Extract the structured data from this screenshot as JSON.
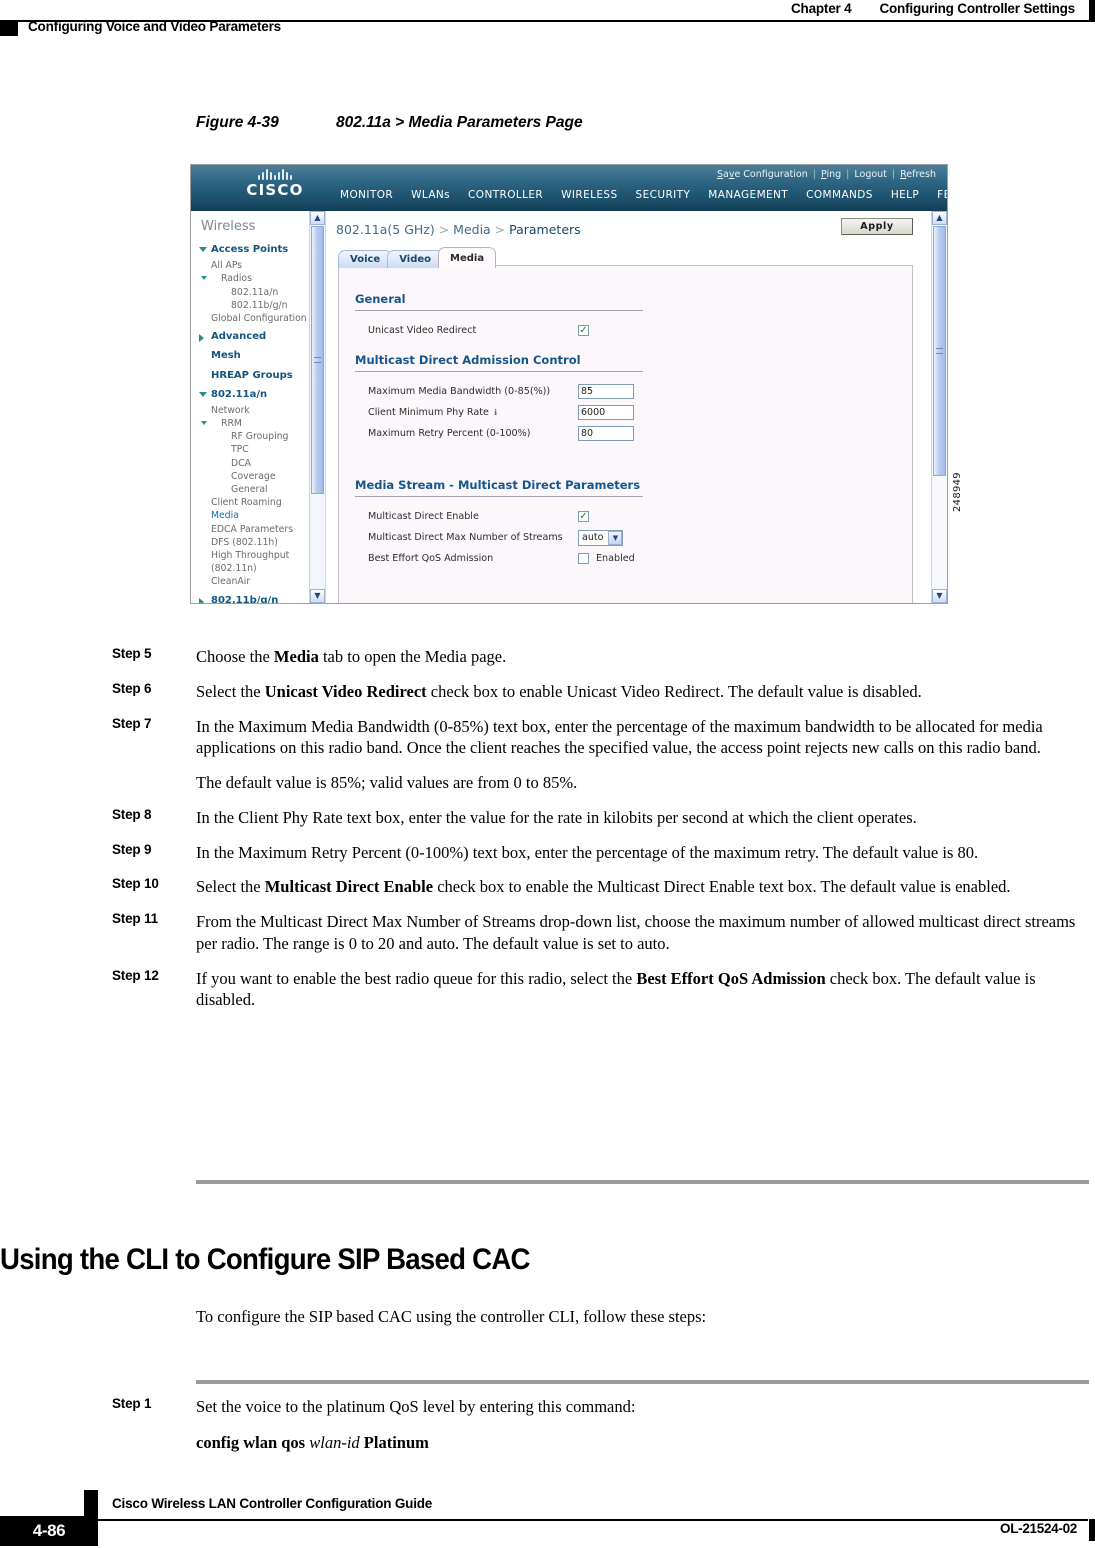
{
  "page_header": {
    "chapter_label": "Chapter 4",
    "chapter_title": "Configuring Controller Settings",
    "section_title": "Configuring Voice and Video Parameters"
  },
  "figure": {
    "number": "Figure 4-39",
    "title": "802.11a > Media Parameters Page",
    "image_id": "248949"
  },
  "screenshot": {
    "brand": "CISCO",
    "util_links": [
      {
        "label": "Save Configuration"
      },
      {
        "label": "Ping"
      },
      {
        "label": "Logout"
      },
      {
        "label": "Refresh"
      }
    ],
    "separator": "|",
    "main_nav": [
      {
        "label": "MONITOR",
        "active": false
      },
      {
        "label": "WLANs",
        "active": false
      },
      {
        "label": "CONTROLLER",
        "active": false
      },
      {
        "label": "WIRELESS",
        "active": true
      },
      {
        "label": "SECURITY",
        "active": false
      },
      {
        "label": "MANAGEMENT",
        "active": false
      },
      {
        "label": "COMMANDS",
        "active": false
      },
      {
        "label": "HELP",
        "active": false
      },
      {
        "label": "FEEDBACK",
        "active": false
      }
    ],
    "sidebar": {
      "title": "Wireless",
      "items": [
        {
          "label": "Access Points",
          "level": "group",
          "expanded": true
        },
        {
          "label": "All APs",
          "level": "1"
        },
        {
          "label": "Radios",
          "level": "1b",
          "expanded": true
        },
        {
          "label": "802.11a/n",
          "level": "2"
        },
        {
          "label": "802.11b/g/n",
          "level": "2"
        },
        {
          "label": "Global Configuration",
          "level": "1"
        },
        {
          "label": "Advanced",
          "level": "group",
          "expanded": false
        },
        {
          "label": "Mesh",
          "level": "group-plain"
        },
        {
          "label": "HREAP Groups",
          "level": "group-plain"
        },
        {
          "label": "802.11a/n",
          "level": "group",
          "expanded": true
        },
        {
          "label": "Network",
          "level": "1"
        },
        {
          "label": "RRM",
          "level": "1b",
          "expanded": true
        },
        {
          "label": "RF Grouping",
          "level": "2"
        },
        {
          "label": "TPC",
          "level": "2"
        },
        {
          "label": "DCA",
          "level": "2"
        },
        {
          "label": "Coverage",
          "level": "2"
        },
        {
          "label": "General",
          "level": "2"
        },
        {
          "label": "Client Roaming",
          "level": "1"
        },
        {
          "label": "Media",
          "level": "1",
          "selected": true
        },
        {
          "label": "EDCA Parameters",
          "level": "1"
        },
        {
          "label": "DFS (802.11h)",
          "level": "1"
        },
        {
          "label": "High Throughput",
          "level": "1"
        },
        {
          "label": "(802.11n)",
          "level": "1"
        },
        {
          "label": "CleanAir",
          "level": "1"
        },
        {
          "label": "802.11b/g/n",
          "level": "group",
          "expanded": false
        }
      ]
    },
    "breadcrumb": {
      "part1": "802.11a(5 GHz)",
      "sep1": " > ",
      "part2": "Media",
      "sep2": " > ",
      "part3": "Parameters"
    },
    "apply_label": "Apply",
    "tabs": [
      {
        "label": "Voice",
        "active": false
      },
      {
        "label": "Video",
        "active": false
      },
      {
        "label": "Media",
        "active": true
      }
    ],
    "sections": [
      {
        "title": "General",
        "rows": [
          {
            "label": "Unicast Video Redirect",
            "control": "checkbox",
            "checked": true
          }
        ]
      },
      {
        "title": "Multicast Direct Admission Control",
        "rows": [
          {
            "label": "Maximum Media Bandwidth (0-85(%))",
            "control": "text",
            "value": "85"
          },
          {
            "label": "Client Minimum Phy Rate",
            "control": "text",
            "value": "6000",
            "info": true
          },
          {
            "label": "Maximum Retry Percent (0-100%)",
            "control": "text",
            "value": "80"
          }
        ]
      },
      {
        "title": "Media Stream - Multicast Direct Parameters",
        "rows": [
          {
            "label": "Multicast Direct Enable",
            "control": "checkbox",
            "checked": true
          },
          {
            "label": "Multicast Direct Max Number of Streams",
            "control": "select",
            "value": "auto"
          },
          {
            "label": "Best Effort QoS Admission",
            "control": "checkbox",
            "checked": false,
            "suffix": "Enabled"
          }
        ]
      }
    ]
  },
  "steps": [
    {
      "label": "Step 5",
      "parts": [
        {
          "t": "Choose the "
        },
        {
          "t": "Media",
          "b": true
        },
        {
          "t": " tab to open the Media page."
        }
      ]
    },
    {
      "label": "Step 6",
      "parts": [
        {
          "t": "Select the "
        },
        {
          "t": "Unicast Video Redirect",
          "b": true
        },
        {
          "t": " check box to enable Unicast Video Redirect. The default value is disabled."
        }
      ]
    },
    {
      "label": "Step 7",
      "parts": [
        {
          "t": "In the Maximum Media Bandwidth (0-85%) text box, enter the percentage of the maximum bandwidth to be allocated for media applications on this radio band. Once the client reaches the specified value, the access point rejects new calls on this radio band."
        }
      ],
      "note": "The default value is 85%; valid values are from 0 to 85%."
    },
    {
      "label": "Step 8",
      "parts": [
        {
          "t": "In the Client Phy Rate text box, enter the value for the rate in kilobits per second at which the client operates."
        }
      ]
    },
    {
      "label": "Step 9",
      "parts": [
        {
          "t": "In the Maximum Retry Percent (0-100%) text box, enter the percentage of the maximum retry. The default value is 80."
        }
      ]
    },
    {
      "label": "Step 10",
      "parts": [
        {
          "t": "Select the "
        },
        {
          "t": "Multicast Direct Enable",
          "b": true
        },
        {
          "t": " check box to enable the Multicast Direct Enable text box. The default value is enabled."
        }
      ]
    },
    {
      "label": "Step 11",
      "parts": [
        {
          "t": "From the Multicast Direct Max Number of Streams drop-down list, choose the maximum number of allowed multicast direct streams per radio. The range is 0 to 20 and auto. The default value is set to auto."
        }
      ]
    },
    {
      "label": "Step 12",
      "parts": [
        {
          "t": "If you want to enable the best radio queue for this radio, select the "
        },
        {
          "t": "Best Effort QoS Admission",
          "b": true
        },
        {
          "t": " check box. The default value is disabled."
        }
      ]
    }
  ],
  "heading": "Using the CLI to Configure SIP Based CAC",
  "intro": "To configure the SIP based CAC using the controller CLI, follow these steps:",
  "cli_steps": [
    {
      "label": "Step 1",
      "parts": [
        {
          "t": "Set the voice to the platinum QoS level by entering this command:"
        }
      ],
      "command": [
        {
          "t": "config wlan qos ",
          "b": true
        },
        {
          "t": "wlan-id",
          "i": true
        },
        {
          "t": " Platinum",
          "b": true
        }
      ]
    }
  ],
  "footer": {
    "guide_title": "Cisco Wireless LAN Controller Configuration Guide",
    "page_number": "4-86",
    "doc_id": "OL-21524-02"
  }
}
